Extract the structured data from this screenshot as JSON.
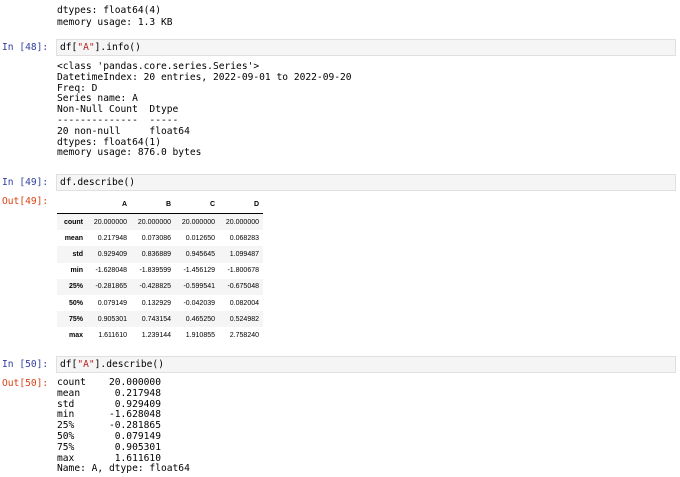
{
  "prev_output": {
    "lines": [
      "dtypes: float64(4)",
      "memory usage: 1.3 KB"
    ]
  },
  "cell48": {
    "prompt": "In [48]:",
    "code_pre": "df[",
    "code_str": "\"A\"",
    "code_post": "].info()",
    "output": "<class 'pandas.core.series.Series'>\nDatetimeIndex: 20 entries, 2022-09-01 to 2022-09-20\nFreq: D\nSeries name: A\nNon-Null Count  Dtype\n--------------  -----\n20 non-null     float64\ndtypes: float64(1)\nmemory usage: 876.0 bytes"
  },
  "cell49": {
    "prompt": "In [49]:",
    "code": "df.describe()",
    "out_prompt": "Out[49]:",
    "table": {
      "columns": [
        "A",
        "B",
        "C",
        "D"
      ],
      "rows": [
        {
          "index": "count",
          "values": [
            "20.000000",
            "20.000000",
            "20.000000",
            "20.000000"
          ]
        },
        {
          "index": "mean",
          "values": [
            "0.217948",
            "0.073086",
            "0.012650",
            "0.068283"
          ]
        },
        {
          "index": "std",
          "values": [
            "0.929409",
            "0.836889",
            "0.945645",
            "1.099487"
          ]
        },
        {
          "index": "min",
          "values": [
            "-1.628048",
            "-1.839599",
            "-1.456129",
            "-1.800678"
          ]
        },
        {
          "index": "25%",
          "values": [
            "-0.281865",
            "-0.428825",
            "-0.599541",
            "-0.675048"
          ]
        },
        {
          "index": "50%",
          "values": [
            "0.079149",
            "0.132929",
            "-0.042039",
            "0.082004"
          ]
        },
        {
          "index": "75%",
          "values": [
            "0.905301",
            "0.743154",
            "0.465250",
            "0.524982"
          ]
        },
        {
          "index": "max",
          "values": [
            "1.611610",
            "1.239144",
            "1.910855",
            "2.758240"
          ]
        }
      ]
    }
  },
  "cell50": {
    "prompt": "In [50]:",
    "code_pre": "df[",
    "code_str": "\"A\"",
    "code_post": "].describe()",
    "out_prompt": "Out[50]:",
    "output": "count    20.000000\nmean      0.217948\nstd       0.929409\nmin      -1.628048\n25%      -0.281865\n50%       0.079149\n75%       0.905301\nmax       1.611610\nName: A, dtype: float64"
  }
}
